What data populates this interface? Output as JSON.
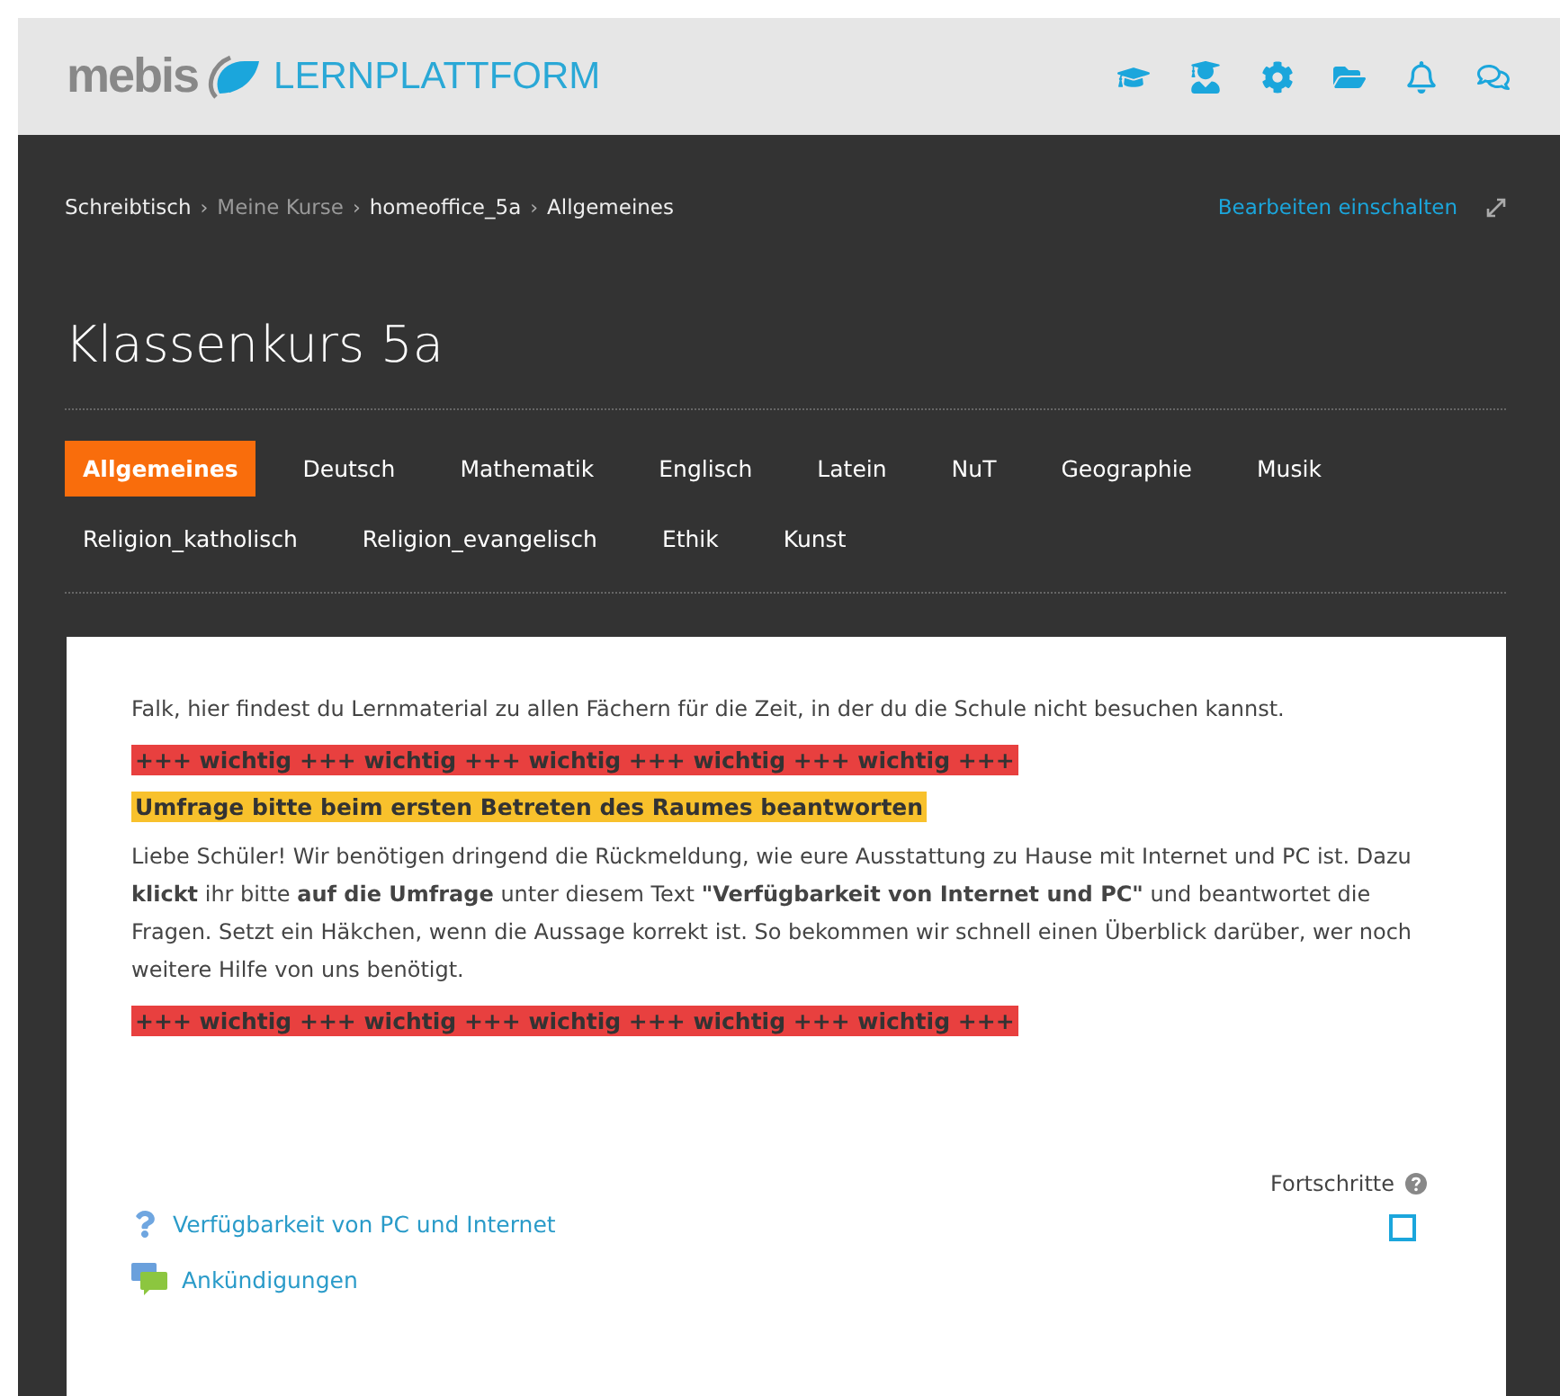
{
  "header": {
    "logo_text": "mebis",
    "logo_subtitle": "LERNPLATTFORM",
    "icons": [
      {
        "kind": "cap"
      },
      {
        "kind": "caps"
      },
      {
        "kind": "gear"
      },
      {
        "kind": "folder"
      },
      {
        "kind": "bell"
      },
      {
        "kind": "chat"
      }
    ]
  },
  "breadcrumb": [
    {
      "label": "Schreibtisch",
      "muted": false
    },
    {
      "label": "Meine Kurse",
      "muted": true
    },
    {
      "label": "homeoffice_5a",
      "muted": false
    },
    {
      "label": "Allgemeines",
      "muted": false
    }
  ],
  "breadcrumb_separator": "›",
  "edit_link": "Bearbeiten einschalten",
  "course_title": "Klassenkurs 5a",
  "tabs": [
    {
      "label": "Allgemeines",
      "selected": true
    },
    {
      "label": "Deutsch",
      "selected": false
    },
    {
      "label": "Mathematik",
      "selected": false
    },
    {
      "label": "Englisch",
      "selected": false
    },
    {
      "label": "Latein",
      "selected": false
    },
    {
      "label": "NuT",
      "selected": false
    },
    {
      "label": "Geographie",
      "selected": false
    },
    {
      "label": "Musik",
      "selected": false
    },
    {
      "label": "Religion_katholisch",
      "selected": false
    },
    {
      "label": "Religion_evangelisch",
      "selected": false
    },
    {
      "label": "Ethik",
      "selected": false
    },
    {
      "label": "Kunst",
      "selected": false
    }
  ],
  "content": [
    {
      "kind": "text",
      "text": "Falk, hier findest du Lernmaterial zu allen Fächern für die Zeit, in der du die Schule nicht besuchen kannst."
    },
    {
      "kind": "alert",
      "color": "#e8403f",
      "text": "+++ wichtig +++ wichtig +++ wichtig +++ wichtig +++ wichtig +++"
    },
    {
      "kind": "alert",
      "color": "#f8c12c",
      "text": "Umfrage bitte beim ersten Betreten des Raumes beantworten"
    },
    {
      "kind": "text",
      "text": "Liebe Schüler! Wir benötigen dringend die Rückmeldung, wie eure Ausstattung zu Hause mit Internet und PC ist. Dazu **klickt** ihr bitte **auf die Umfrage** unter diesem Text **\"Verfügbarkeit von Internet und PC\"** und beantwortet die Fragen. Setzt ein Häkchen, wenn die Aussage korrekt ist. So bekommen wir schnell einen Überblick darüber, wer noch weitere Hilfe von uns benötigt."
    },
    {
      "kind": "alert",
      "color": "#e8403f",
      "text": "+++ wichtig +++ wichtig +++ wichtig +++ wichtig +++ wichtig +++"
    }
  ],
  "progress_label": "Fortschritte",
  "activities": [
    {
      "kind": "question",
      "label": "Verfügbarkeit von PC und Internet",
      "completion_checked": false
    },
    {
      "kind": "forum",
      "label": "Ankündigungen"
    }
  ]
}
